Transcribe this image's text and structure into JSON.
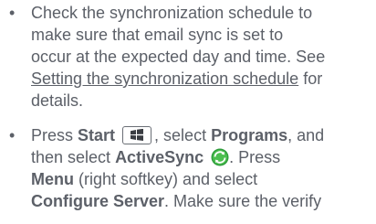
{
  "bullet_glyph": "•",
  "item1": {
    "line1": "Check the synchronization schedule to",
    "line2": "make sure that email sync is set to",
    "line3": "occur at the expected day and time. See",
    "link_text": "Setting the synchronization schedule",
    "line4_after_link": " for",
    "line5": "details."
  },
  "item2": {
    "press_1": "Press ",
    "start_label": "Start",
    "comma_select": ", select ",
    "programs_label": "Programs",
    "and": ", and",
    "then_select": "then select ",
    "activesync_label": "ActiveSync",
    "press_2": ". Press",
    "menu_label": "Menu",
    "menu_desc": " (right softkey) and select",
    "configure_label": "Configure Server",
    "make_sure": ". Make sure the verify"
  },
  "icons": {
    "start_key": "windows-start-key-icon",
    "activesync": "activesync-icon"
  },
  "colors": {
    "text": "#5c6068",
    "activesync_green": "#2f9e3c"
  }
}
